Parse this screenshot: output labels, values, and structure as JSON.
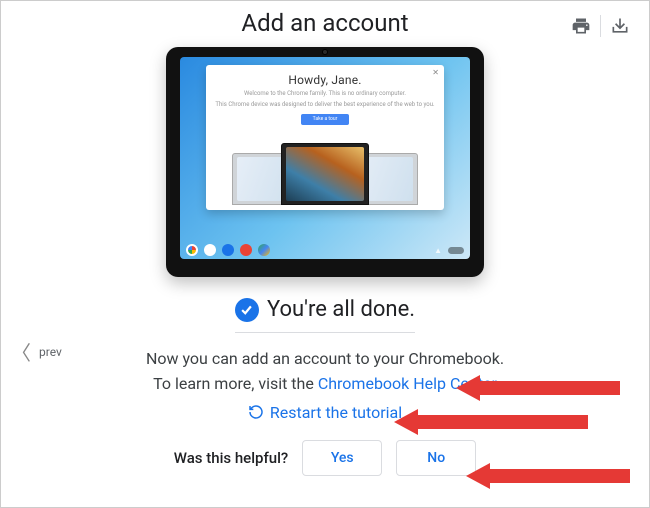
{
  "header": {
    "title": "Add an account",
    "printIcon": "print-icon",
    "downloadIcon": "download-icon"
  },
  "tablet": {
    "modal": {
      "greeting": "Howdy, Jane.",
      "line1": "Welcome to the Chrome family. This is no ordinary computer.",
      "line2": "This Chrome device was designed to deliver the best experience of the web to you.",
      "button": "Take a tour"
    }
  },
  "done": {
    "text": "You're all done."
  },
  "nav": {
    "prev": "prev"
  },
  "desc": {
    "line1": "Now you can add an account to your Chromebook.",
    "line2_prefix": "To learn more, visit the ",
    "link_help": "Chromebook Help Center",
    "restart": "Restart the tutorial"
  },
  "feedback": {
    "label": "Was this helpful?",
    "yes": "Yes",
    "no": "No"
  },
  "colors": {
    "accent": "#1a73e8",
    "annotation": "#e53935"
  }
}
